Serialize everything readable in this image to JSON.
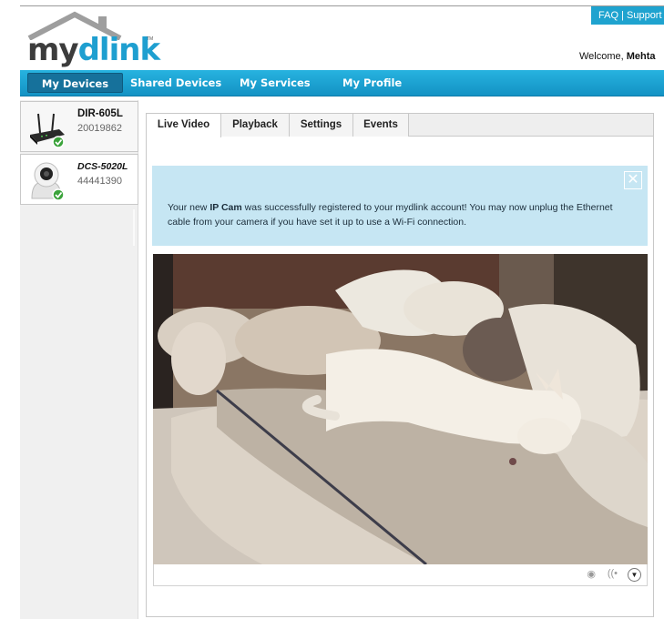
{
  "header": {
    "faq_label": "FAQ",
    "separator": "|",
    "support_label": "Support",
    "logo_my": "my",
    "logo_dlink": "dlink",
    "logo_tm": "TM",
    "welcome_prefix": "Welcome,",
    "welcome_user": "Mehta"
  },
  "nav": {
    "items": [
      {
        "label": "My Devices"
      },
      {
        "label": "Shared Devices"
      },
      {
        "label": "My Services"
      },
      {
        "label": "My Profile"
      }
    ]
  },
  "sidebar": {
    "devices": [
      {
        "name": "DIR-605L",
        "serial": "20019862",
        "icon": "router-icon",
        "status": "check-badge-icon"
      },
      {
        "name": "DCS-5020L",
        "serial": "44441390",
        "icon": "camera-icon",
        "status": "check-badge-icon"
      }
    ]
  },
  "tabs": [
    {
      "label": "Live Video"
    },
    {
      "label": "Playback"
    },
    {
      "label": "Settings"
    },
    {
      "label": "Events"
    }
  ],
  "notice": {
    "text_before": "Your new ",
    "text_bold": "IP Cam",
    "text_after": " was successfully registered to your mydlink account! You may now unplug the Ethernet cable from your camera if you have set it up to use a Wi-Fi connection.",
    "close_icon": "close-icon"
  },
  "video_controls": {
    "record_icon": "record-icon",
    "audio_icon": "audio-icon",
    "menu_icon": "chevron-down-icon"
  },
  "colors": {
    "brand_blue": "#1e9fd0",
    "nav_blue": "#1fa3cf",
    "notice_bg": "#c6e6f3",
    "status_green": "#3ba33b"
  }
}
